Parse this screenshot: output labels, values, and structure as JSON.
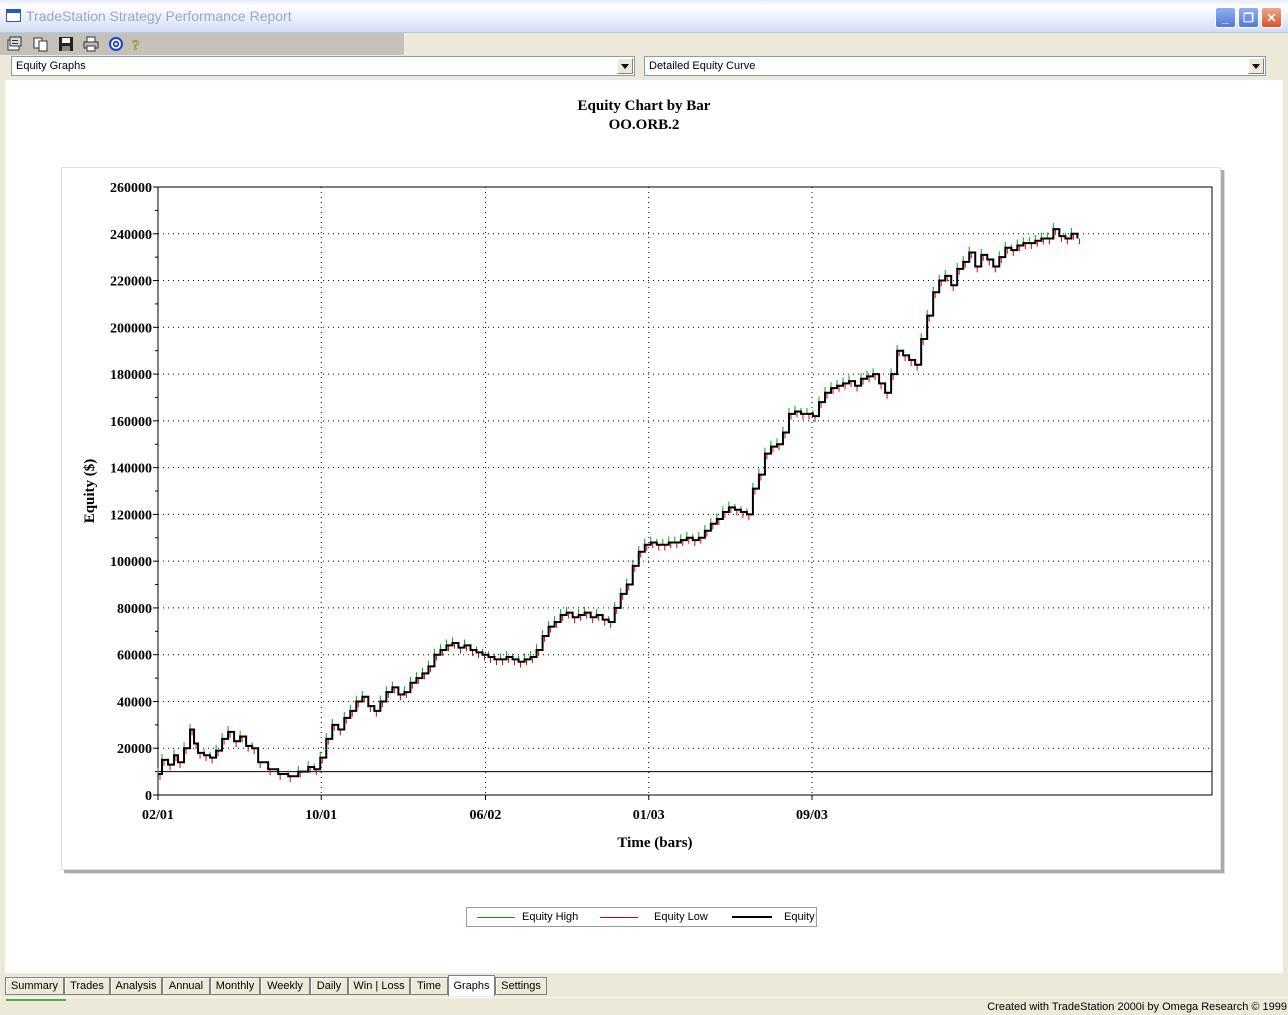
{
  "window": {
    "title": "TradeStation Strategy Performance Report"
  },
  "toolbar": {
    "icons": [
      "properties-icon",
      "copy-icon",
      "save-icon",
      "print-icon",
      "target-icon",
      "help-icon"
    ]
  },
  "selectors": {
    "category": "Equity Graphs",
    "graph": "Detailed Equity Curve"
  },
  "chart": {
    "title": "Equity Chart by Bar",
    "subtitle": "OO.ORB.2"
  },
  "chart_data": {
    "type": "line",
    "title": "Equity Chart by Bar",
    "subtitle": "OO.ORB.2",
    "xlabel": "Time (bars)",
    "ylabel": "Equity ($)",
    "ylim": [
      0,
      260000
    ],
    "yticks": [
      "0",
      "20000",
      "40000",
      "60000",
      "80000",
      "100000",
      "120000",
      "140000",
      "160000",
      "180000",
      "200000",
      "220000",
      "240000",
      "260000"
    ],
    "xticks": [
      "02/01",
      "10/01",
      "06/02",
      "01/03",
      "09/03"
    ],
    "grid": true,
    "baseline": 10000,
    "legend_position": "bottom-center",
    "series": [
      {
        "name": "Equity High",
        "color": "#00aa00"
      },
      {
        "name": "Equity Low",
        "color": "#dd0000"
      },
      {
        "name": "Equity",
        "color": "#000000",
        "points": [
          [
            0,
            9000
          ],
          [
            4,
            15000
          ],
          [
            10,
            13000
          ],
          [
            16,
            17000
          ],
          [
            20,
            14000
          ],
          [
            26,
            20000
          ],
          [
            32,
            28000
          ],
          [
            36,
            22000
          ],
          [
            40,
            18000
          ],
          [
            46,
            17000
          ],
          [
            52,
            16000
          ],
          [
            58,
            19000
          ],
          [
            64,
            24000
          ],
          [
            70,
            27000
          ],
          [
            76,
            23000
          ],
          [
            82,
            25000
          ],
          [
            88,
            21000
          ],
          [
            94,
            20000
          ],
          [
            100,
            14000
          ],
          [
            110,
            11000
          ],
          [
            120,
            9000
          ],
          [
            130,
            8000
          ],
          [
            140,
            10000
          ],
          [
            150,
            12000
          ],
          [
            156,
            11000
          ],
          [
            162,
            16000
          ],
          [
            168,
            24000
          ],
          [
            174,
            30000
          ],
          [
            180,
            28000
          ],
          [
            186,
            33000
          ],
          [
            192,
            36000
          ],
          [
            198,
            40000
          ],
          [
            204,
            42000
          ],
          [
            210,
            38000
          ],
          [
            216,
            36000
          ],
          [
            222,
            40000
          ],
          [
            228,
            44000
          ],
          [
            234,
            46000
          ],
          [
            240,
            43000
          ],
          [
            246,
            44000
          ],
          [
            252,
            48000
          ],
          [
            258,
            50000
          ],
          [
            264,
            52000
          ],
          [
            270,
            55000
          ],
          [
            276,
            60000
          ],
          [
            282,
            62000
          ],
          [
            288,
            64000
          ],
          [
            294,
            65000
          ],
          [
            300,
            63000
          ],
          [
            306,
            64000
          ],
          [
            312,
            62000
          ],
          [
            318,
            61000
          ],
          [
            324,
            60000
          ],
          [
            330,
            59000
          ],
          [
            336,
            58000
          ],
          [
            342,
            58000
          ],
          [
            348,
            59000
          ],
          [
            354,
            58000
          ],
          [
            360,
            57000
          ],
          [
            366,
            58000
          ],
          [
            372,
            59000
          ],
          [
            378,
            62000
          ],
          [
            384,
            68000
          ],
          [
            390,
            72000
          ],
          [
            396,
            74000
          ],
          [
            402,
            77000
          ],
          [
            408,
            78000
          ],
          [
            414,
            76000
          ],
          [
            420,
            77000
          ],
          [
            426,
            78000
          ],
          [
            432,
            76000
          ],
          [
            438,
            77000
          ],
          [
            444,
            75000
          ],
          [
            450,
            74000
          ],
          [
            456,
            80000
          ],
          [
            462,
            86000
          ],
          [
            468,
            90000
          ],
          [
            474,
            98000
          ],
          [
            480,
            104000
          ],
          [
            486,
            107000
          ],
          [
            492,
            108000
          ],
          [
            498,
            107000
          ],
          [
            504,
            107000
          ],
          [
            510,
            108000
          ],
          [
            516,
            108000
          ],
          [
            522,
            109000
          ],
          [
            528,
            110000
          ],
          [
            534,
            109000
          ],
          [
            540,
            110000
          ],
          [
            546,
            113000
          ],
          [
            552,
            116000
          ],
          [
            558,
            118000
          ],
          [
            564,
            121000
          ],
          [
            570,
            123000
          ],
          [
            576,
            122000
          ],
          [
            582,
            121000
          ],
          [
            588,
            120000
          ],
          [
            594,
            131000
          ],
          [
            600,
            137000
          ],
          [
            606,
            146000
          ],
          [
            612,
            149000
          ],
          [
            618,
            150000
          ],
          [
            624,
            155000
          ],
          [
            630,
            163000
          ],
          [
            636,
            164000
          ],
          [
            642,
            163000
          ],
          [
            648,
            163000
          ],
          [
            654,
            162000
          ],
          [
            660,
            168000
          ],
          [
            666,
            172000
          ],
          [
            672,
            174000
          ],
          [
            678,
            175000
          ],
          [
            684,
            176000
          ],
          [
            690,
            177000
          ],
          [
            696,
            175000
          ],
          [
            702,
            178000
          ],
          [
            708,
            179000
          ],
          [
            714,
            180000
          ],
          [
            720,
            176000
          ],
          [
            726,
            172000
          ],
          [
            732,
            180000
          ],
          [
            738,
            190000
          ],
          [
            744,
            188000
          ],
          [
            750,
            186000
          ],
          [
            756,
            184000
          ],
          [
            762,
            195000
          ],
          [
            768,
            205000
          ],
          [
            774,
            215000
          ],
          [
            780,
            220000
          ],
          [
            786,
            222000
          ],
          [
            792,
            218000
          ],
          [
            798,
            225000
          ],
          [
            804,
            228000
          ],
          [
            810,
            232000
          ],
          [
            816,
            226000
          ],
          [
            822,
            231000
          ],
          [
            828,
            229000
          ],
          [
            834,
            226000
          ],
          [
            840,
            230000
          ],
          [
            846,
            234000
          ],
          [
            852,
            233000
          ],
          [
            858,
            235000
          ],
          [
            864,
            236000
          ],
          [
            870,
            236000
          ],
          [
            876,
            237000
          ],
          [
            882,
            238000
          ],
          [
            888,
            238000
          ],
          [
            894,
            242000
          ],
          [
            900,
            239000
          ],
          [
            906,
            238000
          ],
          [
            912,
            240000
          ],
          [
            918,
            238000
          ]
        ]
      }
    ],
    "x_range": [
      0,
      918
    ],
    "x_tick_positions": [
      0,
      163,
      327,
      490,
      653
    ],
    "x_axis_max": 918
  },
  "tabs": [
    "Summary",
    "Trades",
    "Analysis",
    "Annual",
    "Monthly",
    "Weekly",
    "Daily",
    "Win | Loss",
    "Time",
    "Graphs",
    "Settings"
  ],
  "active_tab": "Graphs",
  "status": {
    "credit": "Created with TradeStation 2000i by Omega Research © 1999"
  }
}
